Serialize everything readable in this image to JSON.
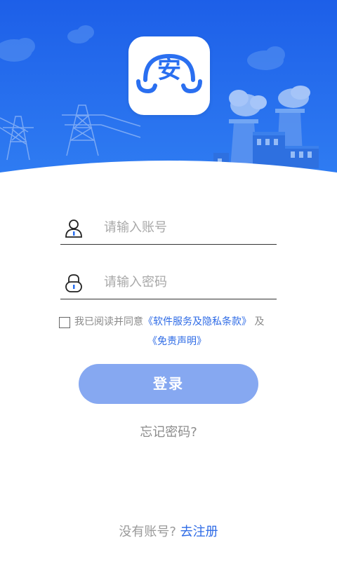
{
  "header": {
    "logo_char": "安",
    "colors": {
      "gradient_top": "#1d5fe8",
      "gradient_bottom": "#2f7cf2",
      "accent": "#2e6be6"
    },
    "decor_icons": [
      "power-tower-icon",
      "factory-icon",
      "cloud-icon"
    ]
  },
  "login": {
    "account_placeholder": "请输入账号",
    "password_placeholder": "请输入密码",
    "agree_prefix": "我已阅读并同意",
    "privacy_link": "《软件服务及隐私条款》",
    "and": "及",
    "disclaimer_link": "《免责声明》",
    "login_button": "登录",
    "forgot_password": "忘记密码?",
    "no_account": "没有账号?",
    "register_link": "去注册"
  }
}
